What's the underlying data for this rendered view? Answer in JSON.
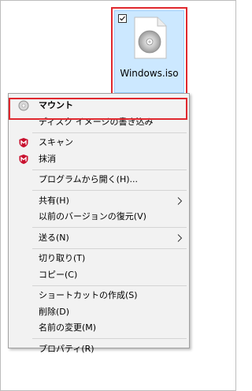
{
  "file": {
    "name": "Windows.iso",
    "checked": true,
    "icon": "disc-image-file-icon"
  },
  "context_menu": {
    "items": [
      {
        "label": "マウント",
        "icon": "disc-mount-icon",
        "bold": true
      },
      {
        "label": "ディスク イメージの書き込み"
      },
      {
        "label": "スキャン",
        "icon": "mcafee-shield-icon"
      },
      {
        "label": "抹消",
        "icon": "mcafee-shield-icon"
      },
      {
        "label": "プログラムから開く(H)..."
      },
      {
        "label": "共有(H)",
        "submenu": true
      },
      {
        "label": "以前のバージョンの復元(V)"
      },
      {
        "label": "送る(N)",
        "submenu": true
      },
      {
        "label": "切り取り(T)"
      },
      {
        "label": "コピー(C)"
      },
      {
        "label": "ショートカットの作成(S)"
      },
      {
        "label": "削除(D)"
      },
      {
        "label": "名前の変更(M)"
      },
      {
        "label": "プロパティ(R)"
      }
    ]
  },
  "colors": {
    "highlight_border": "#e0282e",
    "selection_fill": "#cce8ff",
    "menu_background": "#f2f2f2",
    "mcafee_red": "#c8102e"
  }
}
